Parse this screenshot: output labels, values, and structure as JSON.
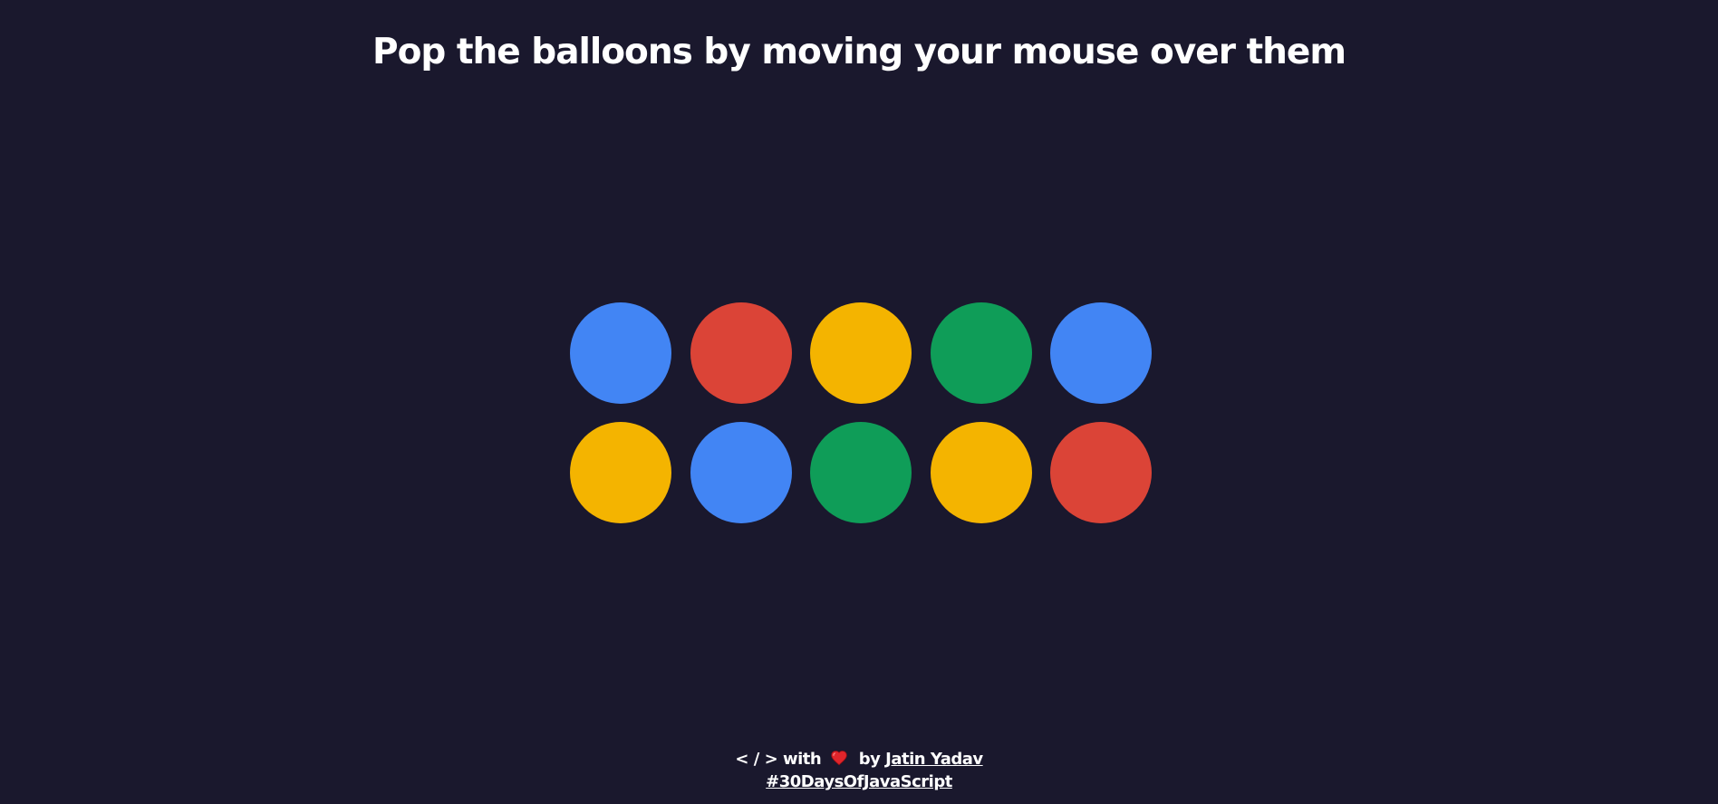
{
  "page": {
    "title": "Pop the balloons by moving your mouse over them"
  },
  "balloons": [
    {
      "color": "#4285f4"
    },
    {
      "color": "#db4437"
    },
    {
      "color": "#f4b400"
    },
    {
      "color": "#0f9d58"
    },
    {
      "color": "#4285f4"
    },
    {
      "color": "#f4b400"
    },
    {
      "color": "#4285f4"
    },
    {
      "color": "#0f9d58"
    },
    {
      "color": "#f4b400"
    },
    {
      "color": "#db4437"
    }
  ],
  "footer": {
    "code_symbol": "< / >",
    "with_text": "with",
    "heart_icon": "heart-icon",
    "by_text": "by",
    "author_link": "Jatin Yadav",
    "hashtag_link": "#30DaysOfJavaScript"
  },
  "colors": {
    "background": "#1a182d",
    "text": "#ffffff",
    "heart": "#e0252b"
  }
}
